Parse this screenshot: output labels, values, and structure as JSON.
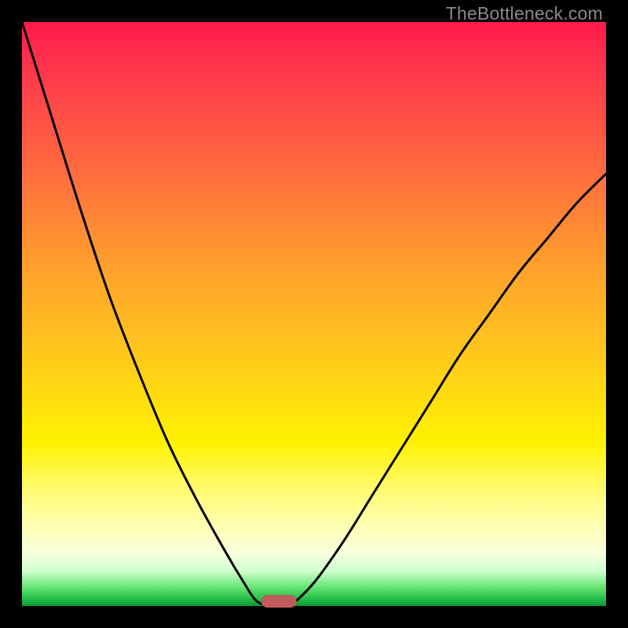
{
  "watermark": "TheBottleneck.com",
  "colors": {
    "frame": "#000000",
    "curve": "#000000",
    "marker": "#c15a5a",
    "gradient_top": "#ff1a4b",
    "gradient_bottom": "#0a9838"
  },
  "chart_data": {
    "type": "line",
    "title": "",
    "xlabel": "",
    "ylabel": "",
    "xlim": [
      0,
      100
    ],
    "ylim": [
      0,
      100
    ],
    "series": [
      {
        "name": "left-curve",
        "x": [
          0,
          5,
          10,
          15,
          20,
          25,
          30,
          35,
          38,
          40,
          42
        ],
        "y": [
          100,
          84,
          68,
          53,
          40,
          28,
          18,
          9,
          4,
          1,
          0
        ]
      },
      {
        "name": "right-curve",
        "x": [
          46,
          50,
          55,
          60,
          65,
          70,
          75,
          80,
          85,
          90,
          95,
          100
        ],
        "y": [
          0,
          4,
          11,
          19,
          27,
          35,
          43,
          50,
          57,
          63,
          69,
          74
        ]
      }
    ],
    "marker": {
      "x_center": 44,
      "y": 0,
      "width": 6
    }
  }
}
